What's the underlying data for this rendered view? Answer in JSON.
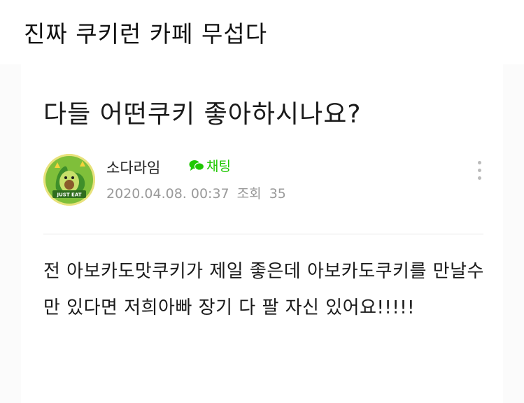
{
  "caption": "진짜 쿠키런 카페 무섭다",
  "post": {
    "title": "다들 어떤쿠키 좋아하시나요?",
    "author": "소다라임",
    "chat_label": "채팅",
    "date": "2020.04.08. 00:37",
    "views_label": "조회",
    "views": "35",
    "avatar_badge": "JUST EAT",
    "body": "전 아보카도맛쿠키가 제일 좋은데 아보카도쿠키를 만날수만 있다면 저희아빠 장기 다 팔 자신 있어요!!!!!"
  },
  "colors": {
    "chat_green": "#1ec800",
    "meta_gray": "#9a9a9a"
  },
  "icons": {
    "chat": "speech-bubble-icon",
    "more": "vertical-ellipsis-icon"
  }
}
